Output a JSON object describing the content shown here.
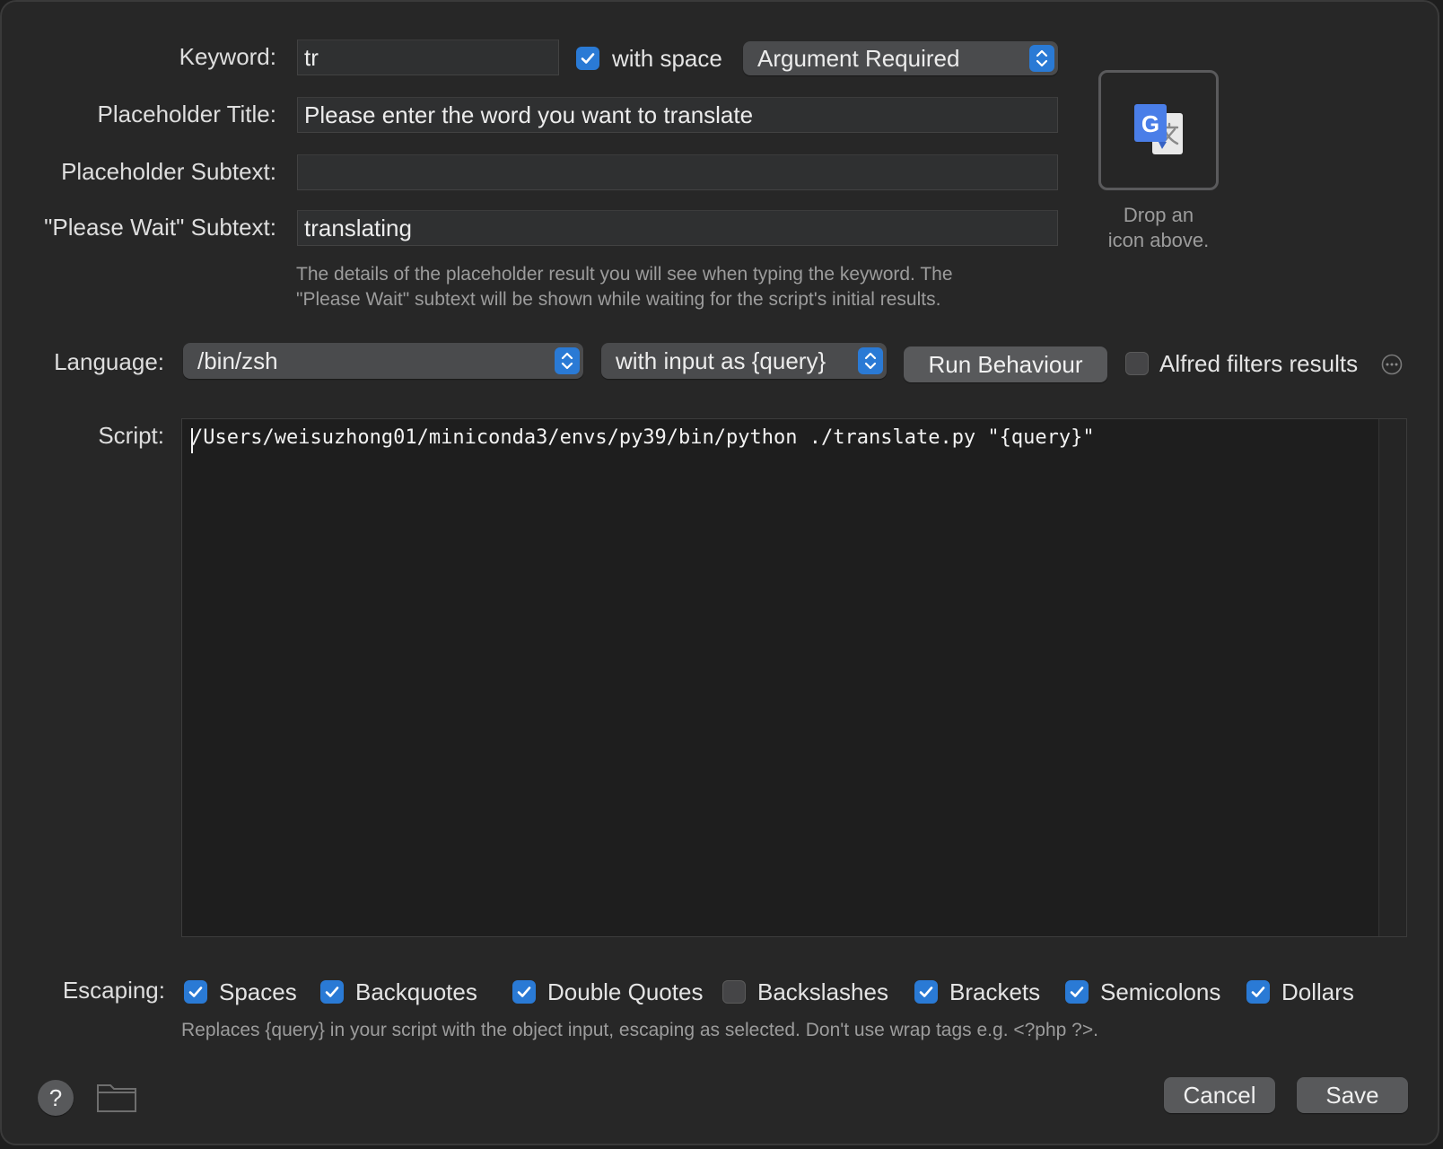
{
  "form": {
    "keyword_label": "Keyword:",
    "keyword_value": "tr",
    "with_space_label": "with space",
    "with_space_checked": true,
    "argument_mode": "Argument Required",
    "placeholder_title_label": "Placeholder Title:",
    "placeholder_title_value": "Please enter the word you want to translate",
    "placeholder_subtext_label": "Placeholder Subtext:",
    "placeholder_subtext_value": "",
    "please_wait_label": "\"Please Wait\" Subtext:",
    "please_wait_value": "translating",
    "details_hint_line1": "The details of the placeholder result you will see when typing the keyword. The",
    "details_hint_line2": "\"Please Wait\" subtext will be shown while waiting for the script's initial results."
  },
  "icon_well": {
    "icon": "google-translate-icon",
    "caption_line1": "Drop an",
    "caption_line2": "icon above."
  },
  "language": {
    "label": "Language:",
    "value": "/bin/zsh",
    "input_mode": "with input as {query}",
    "run_behaviour_label": "Run Behaviour",
    "alfred_filters_label": "Alfred filters results",
    "alfred_filters_checked": false
  },
  "script": {
    "label": "Script:",
    "text": "/Users/weisuzhong01/miniconda3/envs/py39/bin/python ./translate.py \"{query}\""
  },
  "escaping": {
    "label": "Escaping:",
    "options": [
      {
        "label": "Spaces",
        "checked": true
      },
      {
        "label": "Backquotes",
        "checked": true
      },
      {
        "label": "Double Quotes",
        "checked": true
      },
      {
        "label": "Backslashes",
        "checked": false
      },
      {
        "label": "Brackets",
        "checked": true
      },
      {
        "label": "Semicolons",
        "checked": true
      },
      {
        "label": "Dollars",
        "checked": true
      }
    ],
    "hint": "Replaces {query} in your script with the object input, escaping as selected. Don't use wrap tags e.g. <?php ?>."
  },
  "footer": {
    "help_label": "?",
    "folder_icon": "folder-icon",
    "cancel_label": "Cancel",
    "save_label": "Save"
  },
  "colors": {
    "accent": "#2a7ad5",
    "background": "#272727"
  }
}
